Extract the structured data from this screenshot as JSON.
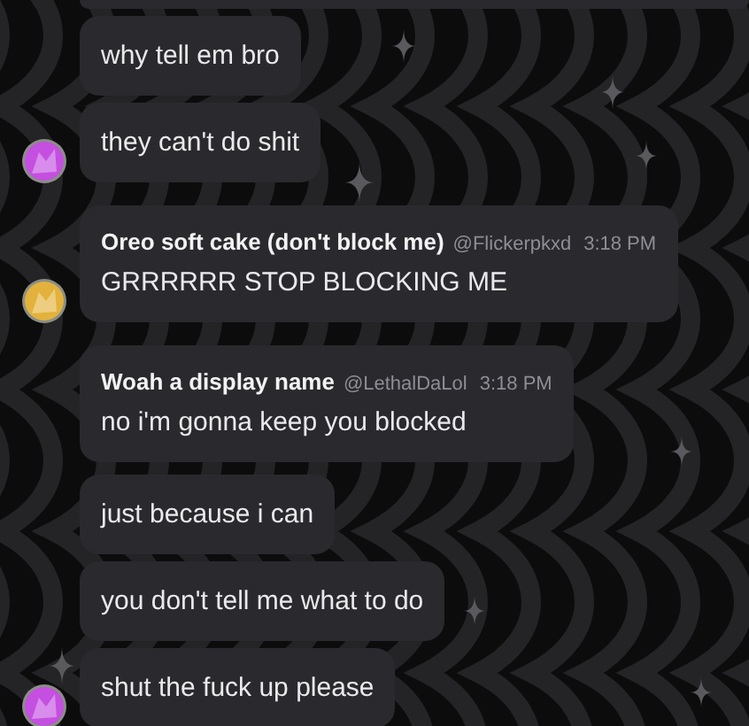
{
  "messages": [
    {
      "text": "why tell em bro"
    },
    {
      "text": "they can't do shit",
      "color": "#c44fe0"
    },
    {
      "author": "Oreo soft cake (don't block me)",
      "handle": "@Flickerpkxd",
      "time": "3:18 PM",
      "text": "GRRRRRR STOP BLOCKING ME",
      "color": "#e3b23c"
    },
    {
      "author": "Woah a display name",
      "handle": "@LethalDaLol",
      "time": "3:18 PM",
      "text": "no i'm gonna keep you blocked"
    },
    {
      "text": "just because i can"
    },
    {
      "text": "you don't tell me what to do"
    },
    {
      "text": "shut the fuck up please",
      "color": "#c44fe0"
    }
  ]
}
